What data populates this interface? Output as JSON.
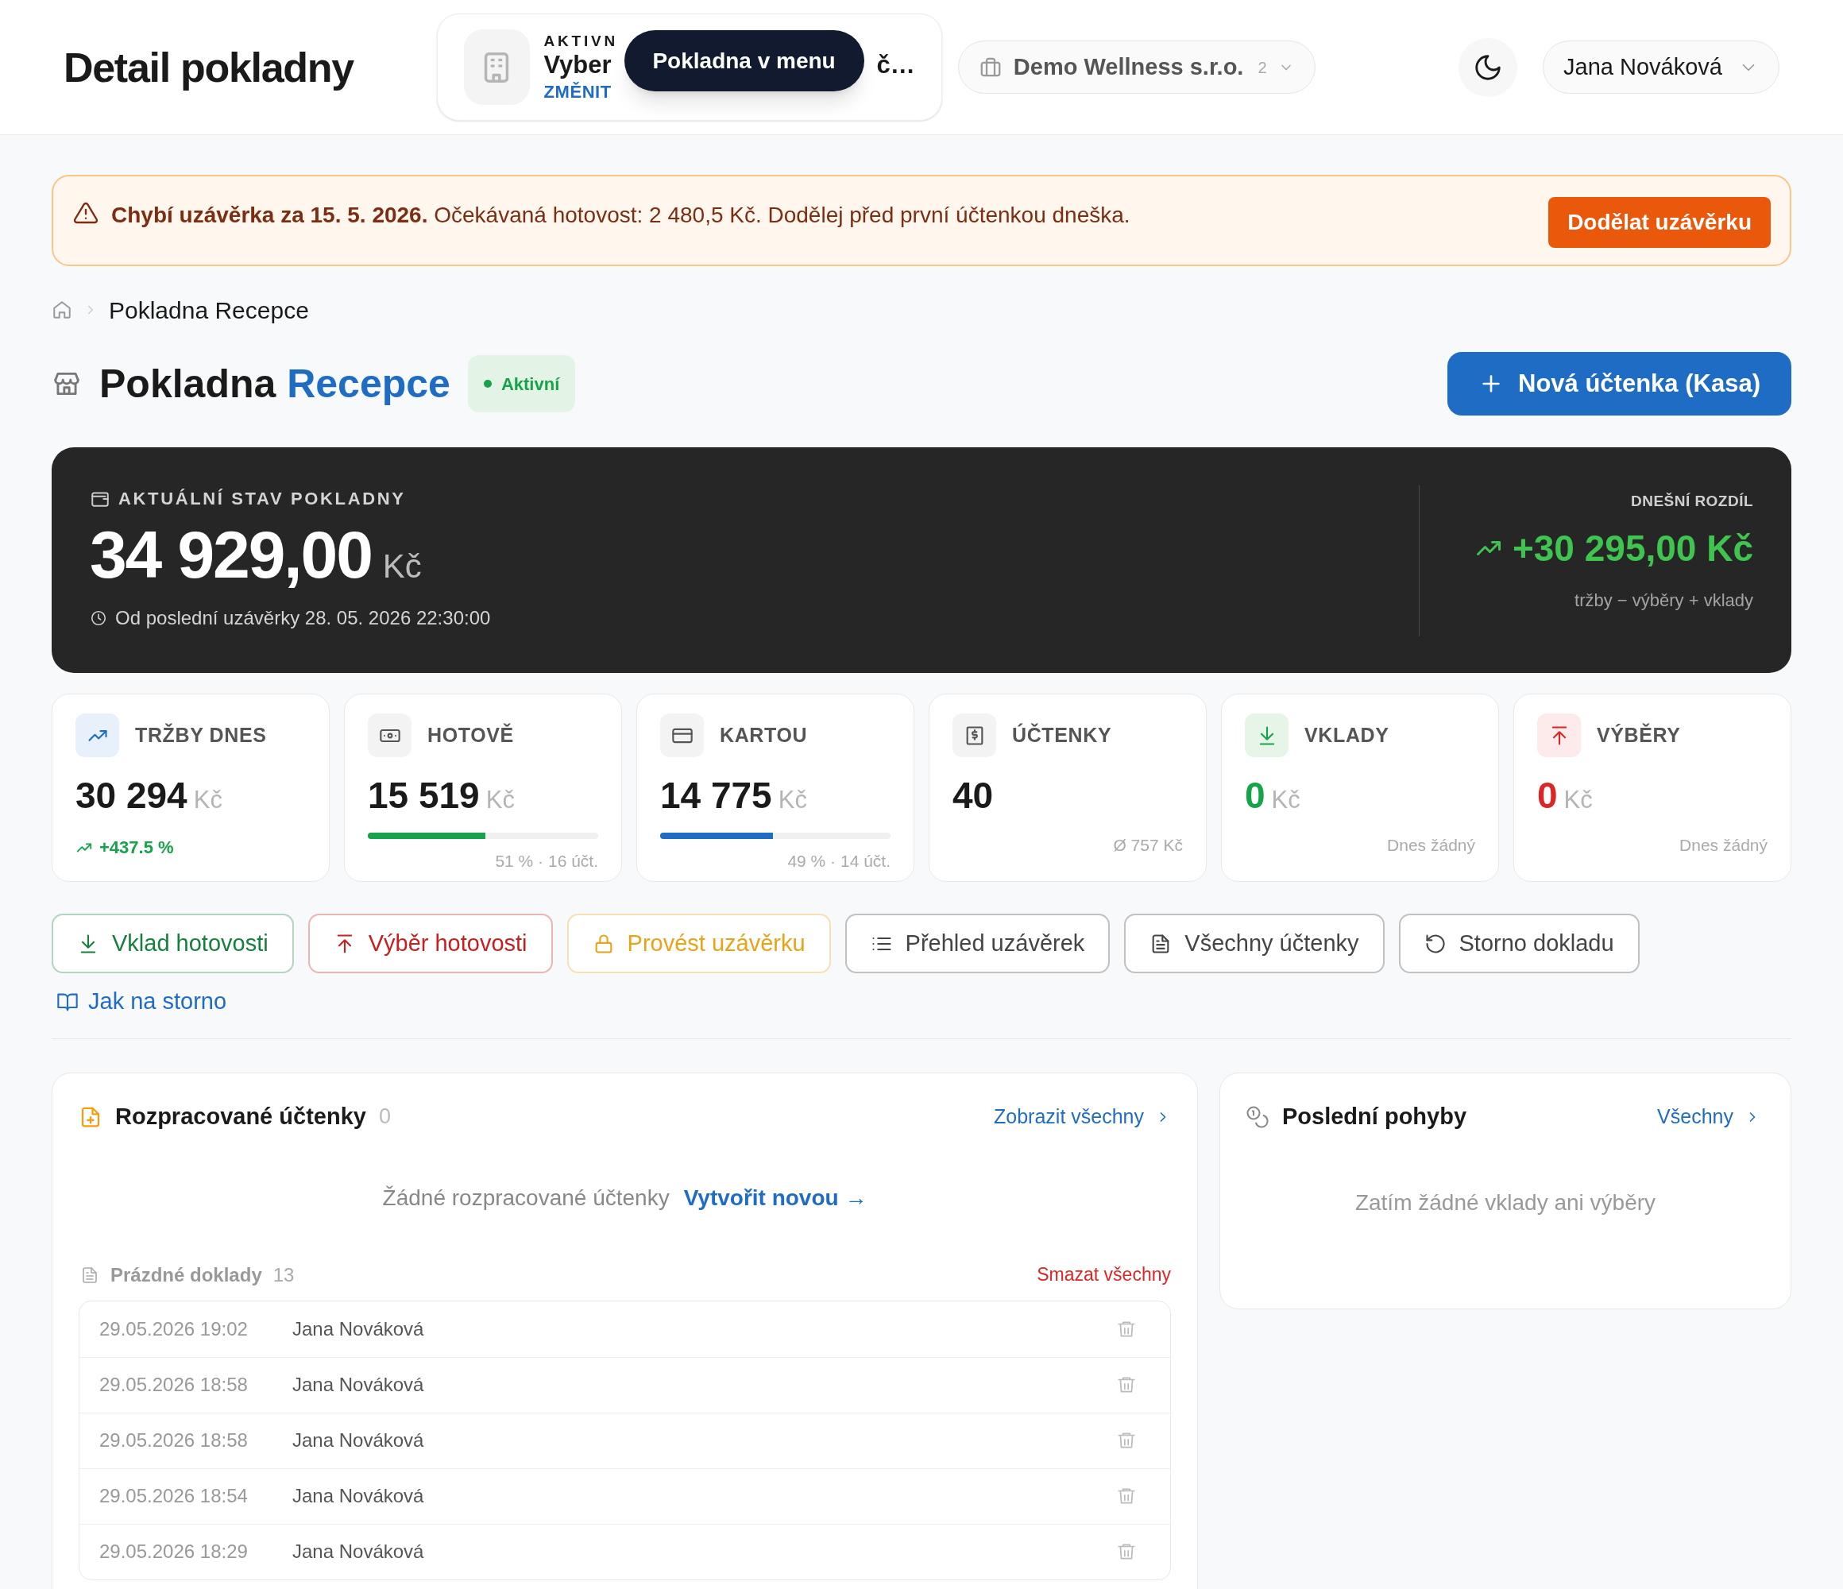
{
  "header": {
    "title": "Detail pokladny",
    "register_picker": {
      "label": "AKTIVN",
      "name_start": "Vyber",
      "name_end": "č…",
      "action": "ZMĚNIT"
    },
    "tooltip": "Pokladna v menu",
    "company": {
      "name": "Demo Wellness s.r.o.",
      "count": "2"
    },
    "user": "Jana Nováková"
  },
  "alert": {
    "text": "**Chybí uzávěrka za 15. 5. 2026.** Očekávaná hotovost: 2 480,5 Kč. Dodělej před první účtenkou dneška.",
    "button": "Dodělat uzávěrku"
  },
  "breadcrumb": [
    "Pokladna Recepce"
  ],
  "page_title": {
    "first": "Pokladna",
    "highlight": "Recepce",
    "status": "Aktivní",
    "button": "Nová účtenka (Kasa)"
  },
  "balance": {
    "label": "AKTUÁLNÍ STAV POKLADNY",
    "amount": "34 929,00",
    "currency": "Kč",
    "since": "Od poslední uzávěrky 28. 05. 2026 22:30:00",
    "diff_label": "DNEŠNÍ ROZDÍL",
    "diff": "+30 295,00 Kč",
    "diff_note": "tržby − výběry + vklady"
  },
  "stats": [
    {
      "kind": "trend",
      "label": "TRŽBY DNES",
      "value": "30 294",
      "currency": "Kč",
      "color": "#1a1a1a",
      "trend": "+437.5 %"
    },
    {
      "kind": "progress",
      "label": "HOTOVĚ",
      "value": "15 519",
      "currency": "Kč",
      "color": "#1a1a1a",
      "level": 0.51,
      "note": "51 % · 16 účt."
    },
    {
      "kind": "progress",
      "label": "KARTOU",
      "value": "14 775",
      "currency": "Kč",
      "color": "#1a1a1a",
      "level": 0.49,
      "note": "49 % · 14 účt."
    },
    {
      "kind": "note",
      "label": "ÚČTENKY",
      "value": "40",
      "color": "#1a1a1a",
      "note": "Ø 757 Kč"
    },
    {
      "kind": "note",
      "label": "VKLADY",
      "value": "0",
      "currency": "Kč",
      "color": "#16a34a",
      "note": "Dnes žádný"
    },
    {
      "kind": "note",
      "label": "VÝBĚRY",
      "value": "0",
      "currency": "Kč",
      "color": "#dc2626",
      "note": "Dnes žádný"
    }
  ],
  "actions": [
    {
      "label": "Vklad hotovosti",
      "color": "#15803d"
    },
    {
      "label": "Výběr hotovosti",
      "color": "#c81e1e"
    },
    {
      "label": "Provést uzávěrku",
      "color": "#e8a317"
    },
    {
      "label": "Přehled uzávěrek",
      "color": "#444444"
    },
    {
      "label": "Všechny účtenky",
      "color": "#444444"
    },
    {
      "label": "Storno dokladu",
      "color": "#444444"
    }
  ],
  "help_link": "Jak na storno",
  "drafts": {
    "title": "Rozpracované účtenky",
    "count": "0",
    "link": "Zobrazit všechny",
    "empty": "Žádné rozpracované účtenky",
    "create": "Vytvořit novou →",
    "blank_title": "Prázdné doklady",
    "blank_count": "13",
    "delete_all": "Smazat všechny",
    "rows": [
      {
        "time": "29.05.2026 19:02",
        "user": "Jana Nováková"
      },
      {
        "time": "29.05.2026 18:58",
        "user": "Jana Nováková"
      },
      {
        "time": "29.05.2026 18:58",
        "user": "Jana Nováková"
      },
      {
        "time": "29.05.2026 18:54",
        "user": "Jana Nováková"
      },
      {
        "time": "29.05.2026 18:29",
        "user": "Jana Nováková"
      }
    ]
  },
  "movements": {
    "title": "Poslední pohyby",
    "link": "Všechny",
    "empty": "Zatím žádné vklady ani výběry"
  }
}
